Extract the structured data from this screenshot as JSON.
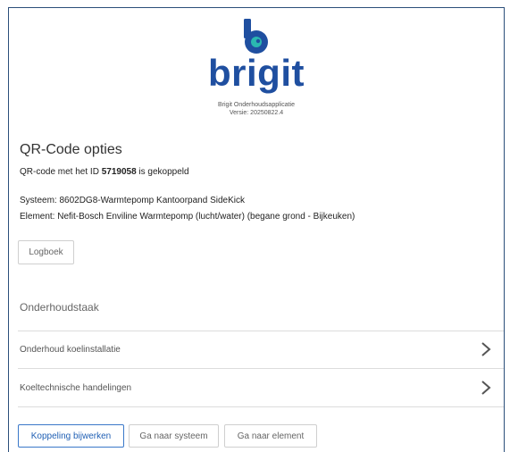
{
  "brand": {
    "name": "brigit",
    "app_name": "Brigit Onderhoudsapplicatie",
    "version": "Versie: 20250822.4",
    "primary_color": "#1f4fa0",
    "accent_color": "#2bb8b0"
  },
  "qr": {
    "section_title": "QR-Code opties",
    "line_prefix": "QR-code met het ID ",
    "id": "5719058",
    "line_suffix": " is gekoppeld"
  },
  "system_line": "Systeem: 8602DG8-Warmtepomp Kantoorpand SideKick",
  "element_line": "Element: Nefit-Bosch Enviline Warmtepomp (lucht/water) (begane grond - Bijkeuken)",
  "logbook_button": "Logboek",
  "maintenance": {
    "title": "Onderhoudstaak",
    "tasks": [
      {
        "label": "Onderhoud koelinstallatie",
        "icon": "chevron-right-icon"
      },
      {
        "label": "Koeltechnische handelingen",
        "icon": "chevron-right-icon"
      }
    ]
  },
  "actions": {
    "update_link": "Koppeling bijwerken",
    "go_to_system": "Ga naar systeem",
    "go_to_element": "Ga naar element"
  }
}
